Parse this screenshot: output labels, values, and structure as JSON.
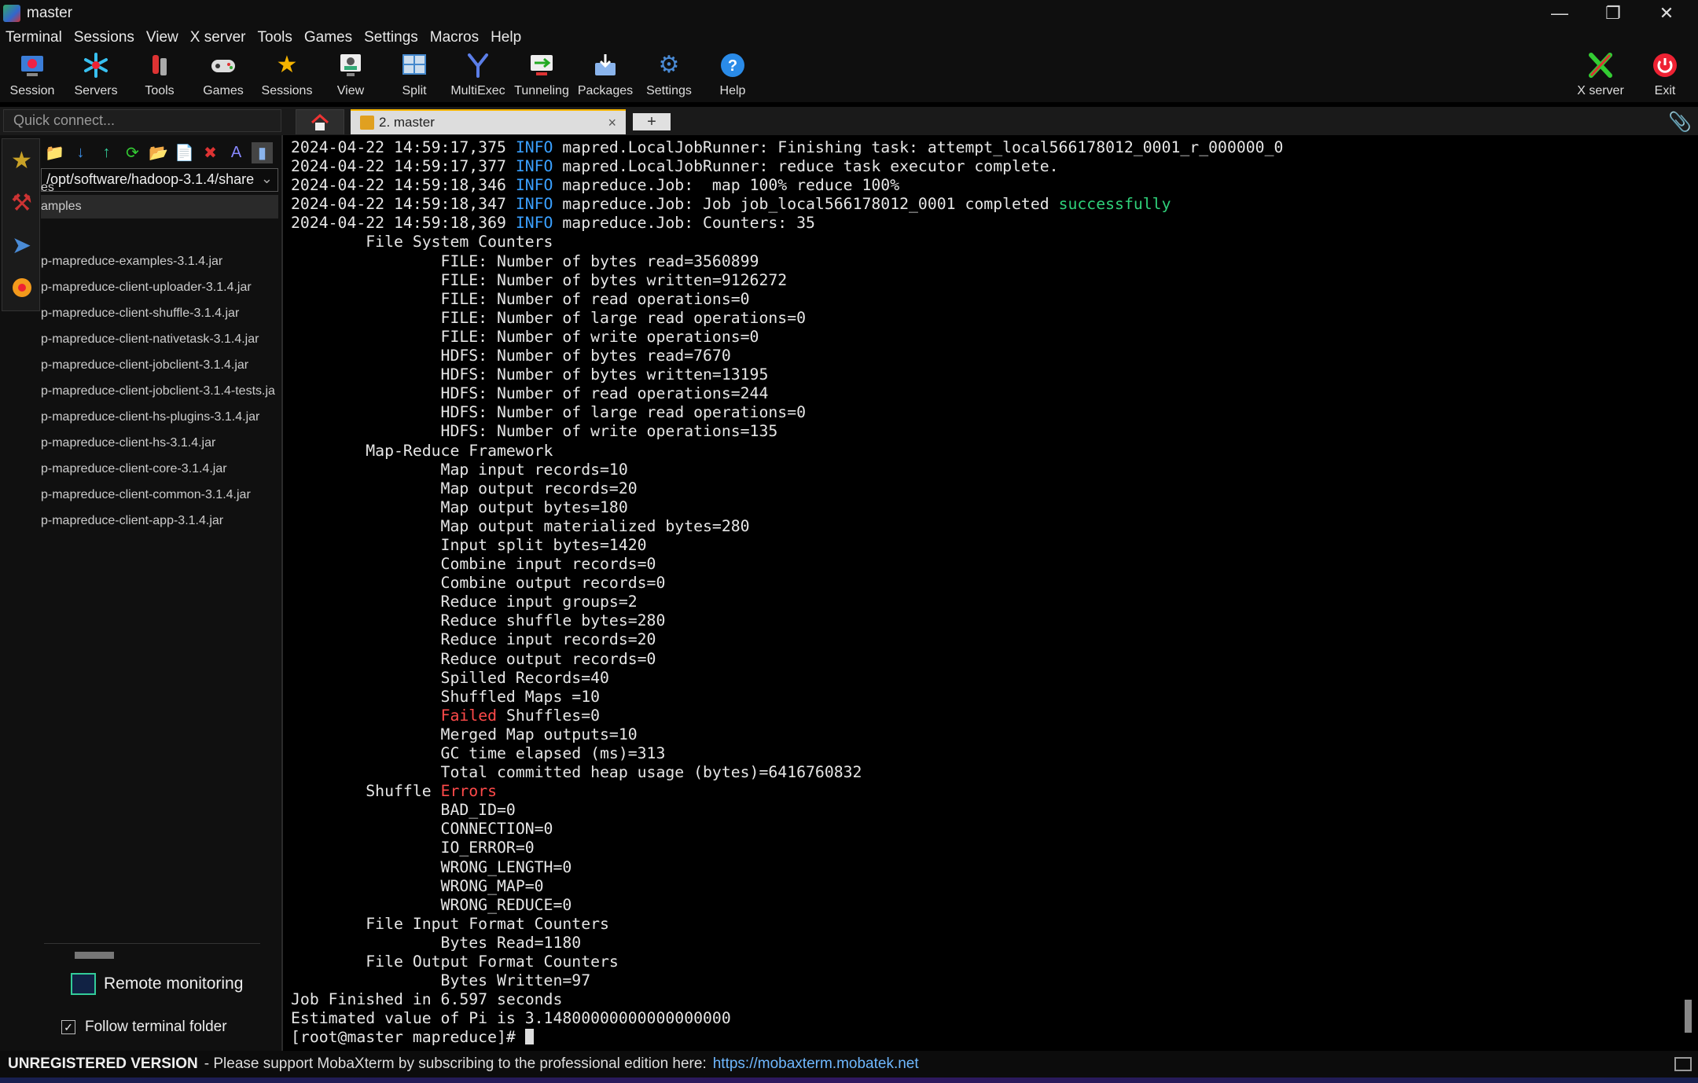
{
  "window": {
    "title": "master"
  },
  "menu": [
    "Terminal",
    "Sessions",
    "View",
    "X server",
    "Tools",
    "Games",
    "Settings",
    "Macros",
    "Help"
  ],
  "toolbar": [
    {
      "label": "Session",
      "icon": "session-icon"
    },
    {
      "label": "Servers",
      "icon": "servers-icon"
    },
    {
      "label": "Tools",
      "icon": "tools-icon"
    },
    {
      "label": "Games",
      "icon": "games-icon"
    },
    {
      "label": "Sessions",
      "icon": "star-icon"
    },
    {
      "label": "View",
      "icon": "view-icon"
    },
    {
      "label": "Split",
      "icon": "split-icon"
    },
    {
      "label": "MultiExec",
      "icon": "multiexec-icon"
    },
    {
      "label": "Tunneling",
      "icon": "tunneling-icon"
    },
    {
      "label": "Packages",
      "icon": "packages-icon"
    },
    {
      "label": "Settings",
      "icon": "gear-icon"
    },
    {
      "label": "Help",
      "icon": "help-icon"
    }
  ],
  "toolbar_right": [
    {
      "label": "X server",
      "icon": "xserver-icon"
    },
    {
      "label": "Exit",
      "icon": "power-icon"
    }
  ],
  "quick_connect": {
    "placeholder": "Quick connect..."
  },
  "tabs": {
    "active_label": "2. master",
    "close": "×",
    "new": "+"
  },
  "sidebar": {
    "path": "/opt/software/hadoop-3.1.4/share",
    "tree": [
      "es",
      "amples"
    ],
    "files": [
      "p-mapreduce-examples-3.1.4.jar",
      "p-mapreduce-client-uploader-3.1.4.jar",
      "p-mapreduce-client-shuffle-3.1.4.jar",
      "p-mapreduce-client-nativetask-3.1.4.jar",
      "p-mapreduce-client-jobclient-3.1.4.jar",
      "p-mapreduce-client-jobclient-3.1.4-tests.ja",
      "p-mapreduce-client-hs-plugins-3.1.4.jar",
      "p-mapreduce-client-hs-3.1.4.jar",
      "p-mapreduce-client-core-3.1.4.jar",
      "p-mapreduce-client-common-3.1.4.jar",
      "p-mapreduce-client-app-3.1.4.jar"
    ],
    "remote_monitoring": "Remote monitoring",
    "follow_folder": "Follow terminal folder",
    "follow_checked": true
  },
  "terminal": {
    "lines": [
      [
        {
          "t": "2024-04-22 14:59:17,375 "
        },
        {
          "t": "INFO",
          "c": "info"
        },
        {
          "t": " mapred.LocalJobRunner: Finishing task: attempt_local566178012_0001_r_000000_0"
        }
      ],
      [
        {
          "t": "2024-04-22 14:59:17,377 "
        },
        {
          "t": "INFO",
          "c": "info"
        },
        {
          "t": " mapred.LocalJobRunner: reduce task executor complete."
        }
      ],
      [
        {
          "t": "2024-04-22 14:59:18,346 "
        },
        {
          "t": "INFO",
          "c": "info"
        },
        {
          "t": " mapreduce.Job:  map 100% reduce 100%"
        }
      ],
      [
        {
          "t": "2024-04-22 14:59:18,347 "
        },
        {
          "t": "INFO",
          "c": "info"
        },
        {
          "t": " mapreduce.Job: Job job_local566178012_0001 completed "
        },
        {
          "t": "successfully",
          "c": "ok"
        }
      ],
      [
        {
          "t": "2024-04-22 14:59:18,369 "
        },
        {
          "t": "INFO",
          "c": "info"
        },
        {
          "t": " mapreduce.Job: Counters: 35"
        }
      ],
      [
        {
          "t": "        File System Counters"
        }
      ],
      [
        {
          "t": "                FILE: Number of bytes read=3560899"
        }
      ],
      [
        {
          "t": "                FILE: Number of bytes written=9126272"
        }
      ],
      [
        {
          "t": "                FILE: Number of read operations=0"
        }
      ],
      [
        {
          "t": "                FILE: Number of large read operations=0"
        }
      ],
      [
        {
          "t": "                FILE: Number of write operations=0"
        }
      ],
      [
        {
          "t": "                HDFS: Number of bytes read=7670"
        }
      ],
      [
        {
          "t": "                HDFS: Number of bytes written=13195"
        }
      ],
      [
        {
          "t": "                HDFS: Number of read operations=244"
        }
      ],
      [
        {
          "t": "                HDFS: Number of large read operations=0"
        }
      ],
      [
        {
          "t": "                HDFS: Number of write operations=135"
        }
      ],
      [
        {
          "t": "        Map-Reduce Framework"
        }
      ],
      [
        {
          "t": "                Map input records=10"
        }
      ],
      [
        {
          "t": "                Map output records=20"
        }
      ],
      [
        {
          "t": "                Map output bytes=180"
        }
      ],
      [
        {
          "t": "                Map output materialized bytes=280"
        }
      ],
      [
        {
          "t": "                Input split bytes=1420"
        }
      ],
      [
        {
          "t": "                Combine input records=0"
        }
      ],
      [
        {
          "t": "                Combine output records=0"
        }
      ],
      [
        {
          "t": "                Reduce input groups=2"
        }
      ],
      [
        {
          "t": "                Reduce shuffle bytes=280"
        }
      ],
      [
        {
          "t": "                Reduce input records=20"
        }
      ],
      [
        {
          "t": "                Reduce output records=0"
        }
      ],
      [
        {
          "t": "                Spilled Records=40"
        }
      ],
      [
        {
          "t": "                Shuffled Maps =10"
        }
      ],
      [
        {
          "t": "                "
        },
        {
          "t": "Failed",
          "c": "err"
        },
        {
          "t": " Shuffles=0"
        }
      ],
      [
        {
          "t": "                Merged Map outputs=10"
        }
      ],
      [
        {
          "t": "                GC time elapsed (ms)=313"
        }
      ],
      [
        {
          "t": "                Total committed heap usage (bytes)=6416760832"
        }
      ],
      [
        {
          "t": "        Shuffle "
        },
        {
          "t": "Errors",
          "c": "err"
        }
      ],
      [
        {
          "t": "                BAD_ID=0"
        }
      ],
      [
        {
          "t": "                CONNECTION=0"
        }
      ],
      [
        {
          "t": "                IO_ERROR=0"
        }
      ],
      [
        {
          "t": "                WRONG_LENGTH=0"
        }
      ],
      [
        {
          "t": "                WRONG_MAP=0"
        }
      ],
      [
        {
          "t": "                WRONG_REDUCE=0"
        }
      ],
      [
        {
          "t": "        File Input Format Counters"
        }
      ],
      [
        {
          "t": "                Bytes Read=1180"
        }
      ],
      [
        {
          "t": "        File Output Format Counters"
        }
      ],
      [
        {
          "t": "                Bytes Written=97"
        }
      ],
      [
        {
          "t": "Job Finished in 6.597 seconds"
        }
      ],
      [
        {
          "t": "Estimated value of Pi is 3.14800000000000000000"
        }
      ]
    ],
    "prompt": "[root@master mapreduce]# "
  },
  "status": {
    "unregistered": "UNREGISTERED VERSION",
    "message": "-  Please support MobaXterm by subscribing to the professional edition here:",
    "link": "https://mobaxterm.mobatek.net"
  },
  "colors": {
    "info": "#3aa0ff",
    "ok": "#2fd17a",
    "err": "#ff4a4a",
    "accent": "#f5b400"
  }
}
